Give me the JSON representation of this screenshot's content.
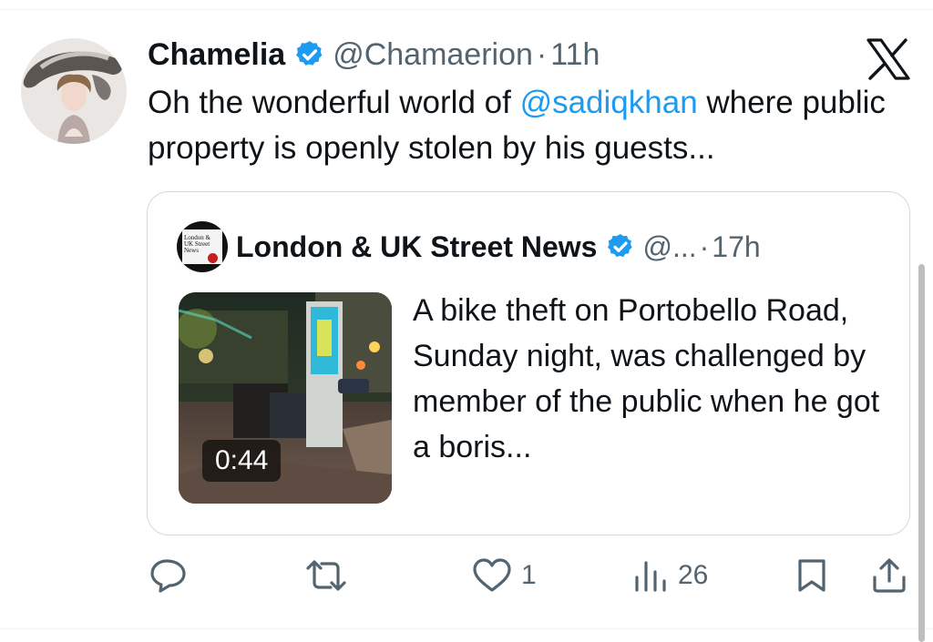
{
  "tweet": {
    "author_name": "Chamelia",
    "handle": "@Chamaerion",
    "separator": "·",
    "time": "11h",
    "text_before": "Oh the wonderful world of ",
    "mention": "@sadiqkhan",
    "text_after": " where public property is openly stolen by his guests..."
  },
  "quote": {
    "avatar_text": "London & UK Street News",
    "name": "London & UK Street News",
    "handle": "@...",
    "separator": "·",
    "time": "17h",
    "text": "A bike theft on Portobello Road, Sunday night, was challenged by member of the public when he got a boris...",
    "media": {
      "duration": "0:44"
    }
  },
  "actions": {
    "reply_icon": "reply-icon",
    "retweet_icon": "retweet-icon",
    "like_icon": "heart-icon",
    "like_count": "1",
    "views_icon": "views-icon",
    "views_count": "26",
    "bookmark_icon": "bookmark-icon",
    "share_icon": "share-icon"
  },
  "colors": {
    "link": "#1d9bf0",
    "text": "#0f1419",
    "secondary": "#536471",
    "verified": "#1d9bf0",
    "border": "#cfd9de"
  }
}
